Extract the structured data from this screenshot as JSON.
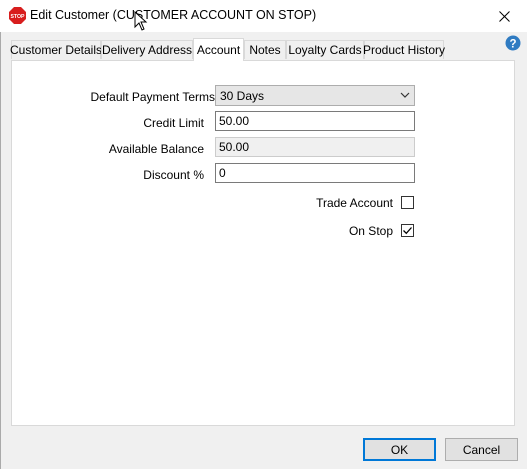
{
  "window": {
    "title": "Edit Customer (CUSTOMER ACCOUNT ON STOP)",
    "close_glyph": "✕",
    "icon_label": "STOP",
    "icon_color": "#d81e1e"
  },
  "tabs": [
    {
      "label": "Customer Details",
      "active": false
    },
    {
      "label": "Delivery Address",
      "active": false
    },
    {
      "label": "Account",
      "active": true
    },
    {
      "label": "Notes",
      "active": false
    },
    {
      "label": "Loyalty Cards",
      "active": false
    },
    {
      "label": "Product History",
      "active": false
    }
  ],
  "help": {
    "glyph": "?",
    "color": "#2f7bc2"
  },
  "account": {
    "payment_terms": {
      "label": "Default Payment Terms",
      "value": "30 Days"
    },
    "credit_limit": {
      "label": "Credit Limit",
      "value": "50.00"
    },
    "available_balance": {
      "label": "Available Balance",
      "value": "50.00"
    },
    "discount": {
      "label": "Discount %",
      "value": "0"
    },
    "trade_account": {
      "label": "Trade Account",
      "checked": false
    },
    "on_stop": {
      "label": "On Stop",
      "checked": true
    }
  },
  "buttons": {
    "ok": "OK",
    "cancel": "Cancel"
  },
  "colors": {
    "accent": "#0078d7",
    "panel_bg": "#ffffff",
    "dialog_bg": "#f0f0f0"
  }
}
